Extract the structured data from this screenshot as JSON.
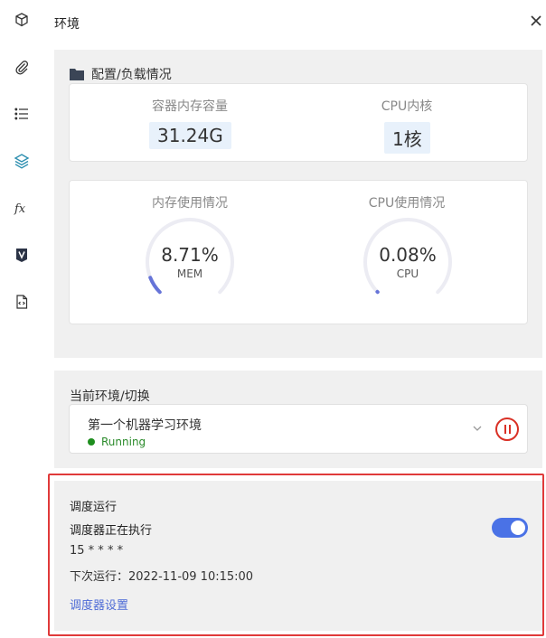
{
  "header": {
    "title": "环境"
  },
  "config": {
    "title": "配置/负载情况",
    "memory_label": "容器内存容量",
    "memory_value": "31.24G",
    "cpu_label": "CPU内核",
    "cpu_value": "1核"
  },
  "usage": {
    "mem": {
      "label": "内存使用情况",
      "percent_text": "8.71%",
      "sub": "MEM",
      "fraction": 0.0871
    },
    "cpu": {
      "label": "CPU使用情况",
      "percent_text": "0.08%",
      "sub": "CPU",
      "fraction": 0.0008
    }
  },
  "environment": {
    "title": "当前环境/切换",
    "selected": "第一个机器学习环境",
    "status": "Running"
  },
  "scheduler": {
    "title": "调度运行",
    "running_text": "调度器正在执行",
    "cron": "15 * * * *",
    "next_run": "下次运行：2022-11-09 10:15:00",
    "settings_link": "调度器设置",
    "enabled": true
  },
  "colors": {
    "accent": "#4a72e6",
    "gauge": "#6674d8",
    "danger": "#d93025",
    "running": "#1e8e1e"
  },
  "icons": [
    "cube-icon",
    "paperclip-icon",
    "list-icon",
    "layers-icon",
    "function-icon",
    "v-badge-icon",
    "code-file-icon",
    "close-icon",
    "folder-icon",
    "chevron-down-icon",
    "pause-icon"
  ]
}
